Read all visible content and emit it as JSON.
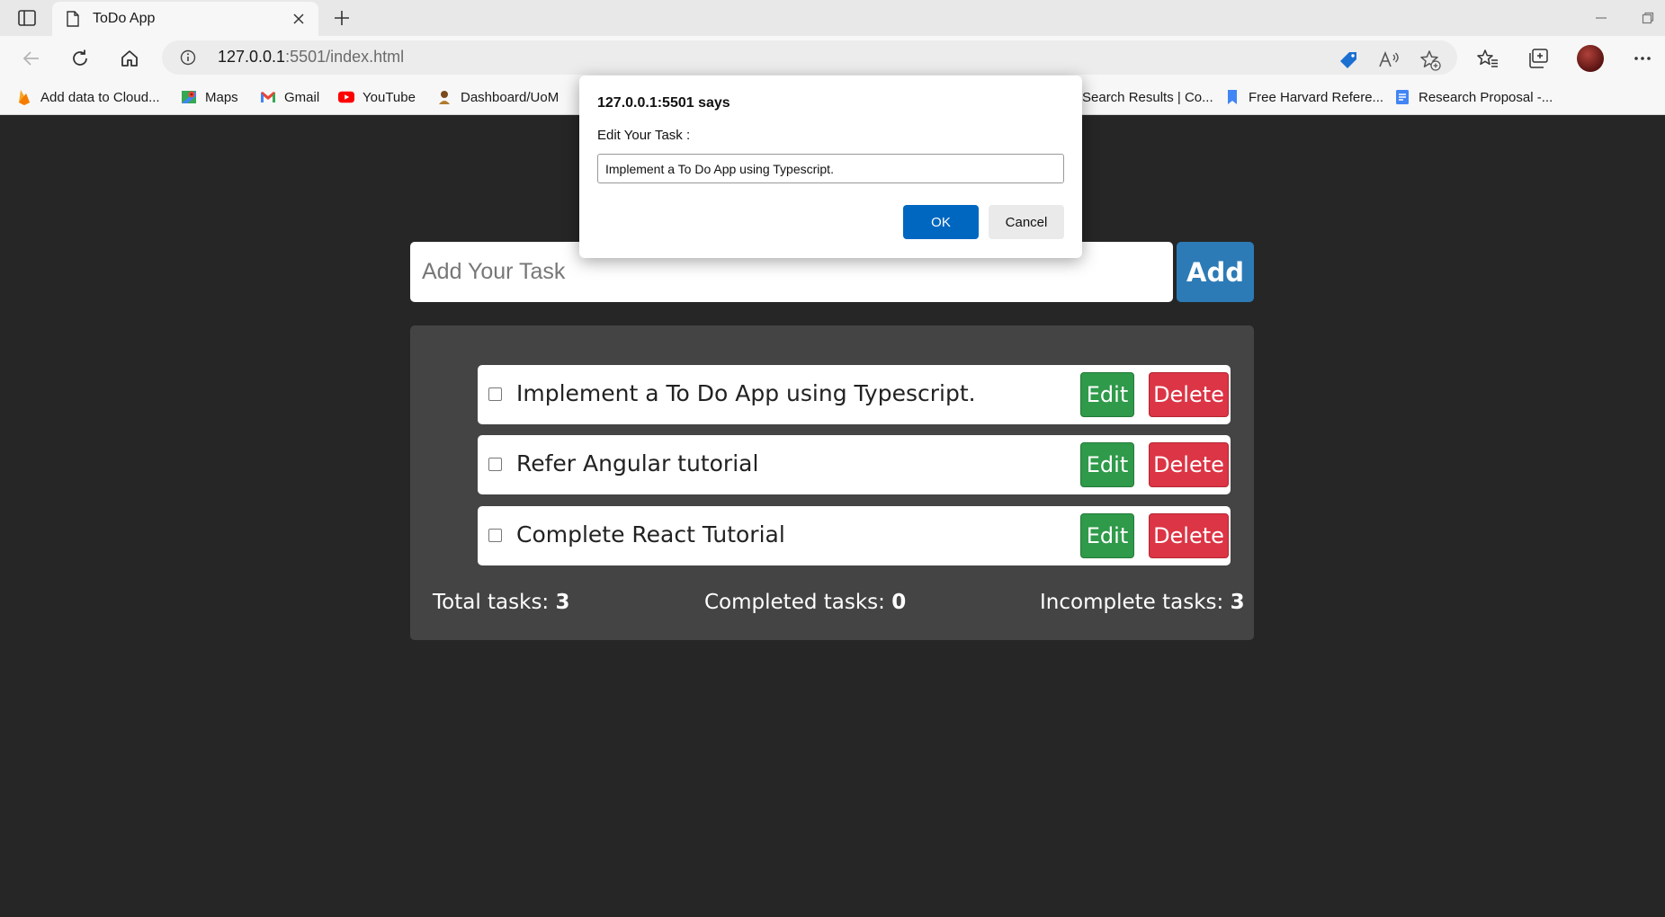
{
  "browser": {
    "tab_title": "ToDo App",
    "url_host": "127.0.0.1",
    "url_rest": ":5501/index.html",
    "bookmarks": [
      {
        "label": "Add data to Cloud...",
        "icon": "firebase-icon"
      },
      {
        "label": "Maps",
        "icon": "maps-icon"
      },
      {
        "label": "Gmail",
        "icon": "gmail-icon"
      },
      {
        "label": "YouTube",
        "icon": "youtube-icon"
      },
      {
        "label": "Dashboard/UoM",
        "icon": "uom-icon"
      },
      {
        "label": "Search Results | Co...",
        "icon": "page-icon"
      },
      {
        "label": "Free Harvard Refere...",
        "icon": "bookmark-icon"
      },
      {
        "label": "Research Proposal -...",
        "icon": "docs-icon"
      }
    ]
  },
  "app": {
    "input_placeholder": "Add Your Task",
    "add_label": "Add",
    "tasks": [
      {
        "text": "Implement a To Do App using Typescript.",
        "done": false
      },
      {
        "text": "Refer Angular tutorial",
        "done": false
      },
      {
        "text": "Complete React Tutorial",
        "done": false
      }
    ],
    "edit_label": "Edit",
    "delete_label": "Delete",
    "stats": {
      "total_label": "Total tasks:",
      "total": "3",
      "completed_label": "Completed tasks:",
      "completed": "0",
      "incomplete_label": "Incomplete tasks:",
      "incomplete": "3"
    }
  },
  "dialog": {
    "title": "127.0.0.1:5501 says",
    "message": "Edit Your Task :",
    "value": "Implement a To Do App using Typescript.",
    "ok_label": "OK",
    "cancel_label": "Cancel"
  },
  "colors": {
    "page_bg": "#262626",
    "panel_bg": "#444444",
    "add_button": "#2c7bb6",
    "edit_button": "#2f9a4a",
    "delete_button": "#dc3545",
    "ok_button": "#0067c0"
  }
}
